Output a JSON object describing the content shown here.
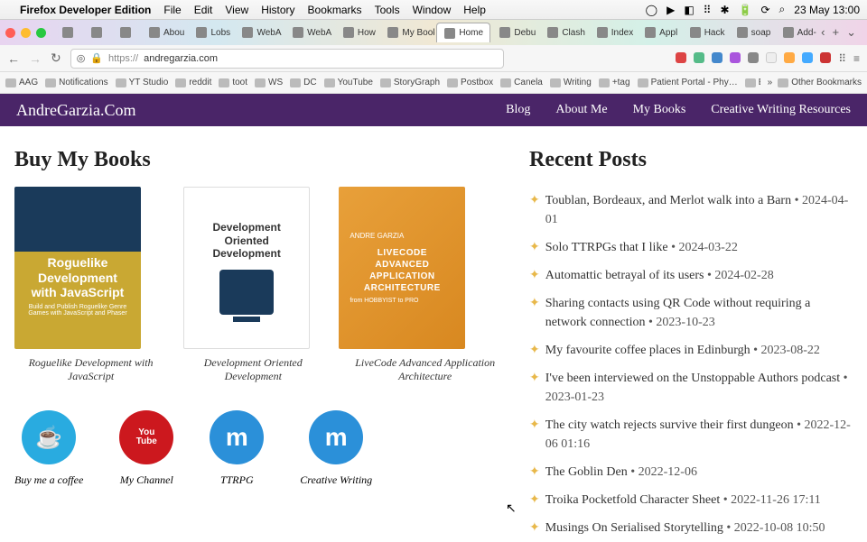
{
  "menubar": {
    "app": "Firefox Developer Edition",
    "items": [
      "File",
      "Edit",
      "View",
      "History",
      "Bookmarks",
      "Tools",
      "Window",
      "Help"
    ],
    "clock": "23 May 13:00"
  },
  "tabs": {
    "list": [
      {
        "label": ""
      },
      {
        "label": ""
      },
      {
        "label": ""
      },
      {
        "label": "Abou"
      },
      {
        "label": "Lobs"
      },
      {
        "label": "WebA"
      },
      {
        "label": "WebA"
      },
      {
        "label": "How"
      },
      {
        "label": "My Book"
      },
      {
        "label": "Home"
      },
      {
        "label": "Debu"
      },
      {
        "label": "Clash"
      },
      {
        "label": "Index"
      },
      {
        "label": "Appl"
      },
      {
        "label": "Hack"
      },
      {
        "label": "soap"
      },
      {
        "label": "Add-"
      }
    ],
    "active_index": 9
  },
  "url": {
    "scheme": "https://",
    "host": "andregarzia.com"
  },
  "bookmarks": {
    "items": [
      "AAG",
      "Notifications",
      "YT Studio",
      "reddit",
      "toot",
      "WS",
      "DC",
      "YouTube",
      "StoryGraph",
      "Postbox",
      "Canela",
      "Writing",
      "+tag",
      "Patient Portal - Phy…",
      "Exercises to help wi…"
    ],
    "other": "Other Bookmarks"
  },
  "nav": {
    "logo": "AndreGarzia.Com",
    "links": [
      "Blog",
      "About Me",
      "My Books",
      "Creative Writing Resources"
    ]
  },
  "books": {
    "heading": "Buy My Books",
    "items": [
      {
        "title": "Roguelike Development with JavaScript",
        "cover_title": "Roguelike Development with JavaScript",
        "sub": "Build and Publish Roguelike Genre Games with JavaScript and Phaser"
      },
      {
        "title": "Development Oriented Development",
        "cover_title": "Development Oriented Development"
      },
      {
        "title": "LiveCode Advanced Application Architecture",
        "cover_title": "LIVECODE ADVANCED APPLICATION ARCHITECTURE",
        "sub": "from HOBBYIST to PRO"
      }
    ]
  },
  "socials": [
    {
      "label": "Buy me a coffee",
      "glyph": "☕"
    },
    {
      "label": "My Channel",
      "glyph": "You Tube"
    },
    {
      "label": "TTRPG",
      "glyph": "m"
    },
    {
      "label": "Creative Writing",
      "glyph": "m"
    }
  ],
  "posts": {
    "heading": "Recent Posts",
    "items": [
      {
        "title": "Toublan, Bordeaux, and Merlot walk into a Barn",
        "date": "2024-04-01"
      },
      {
        "title": "Solo TTRPGs that I like",
        "date": "2024-03-22"
      },
      {
        "title": "Automattic betrayal of its users",
        "date": "2024-02-28"
      },
      {
        "title": "Sharing contacts using QR Code without requiring a network connection",
        "date": "2023-10-23"
      },
      {
        "title": "My favourite coffee places in Edinburgh",
        "date": "2023-08-22"
      },
      {
        "title": "I've been interviewed on the Unstoppable Authors podcast",
        "date": "2023-01-23"
      },
      {
        "title": "The city watch rejects survive their first dungeon",
        "date": "2022-12-06 01:16"
      },
      {
        "title": "The Goblin Den",
        "date": "2022-12-06"
      },
      {
        "title": "Troika Pocketfold Character Sheet",
        "date": "2022-11-26 17:11"
      },
      {
        "title": "Musings On Serialised Storytelling",
        "date": "2022-10-08 10:50"
      }
    ]
  }
}
